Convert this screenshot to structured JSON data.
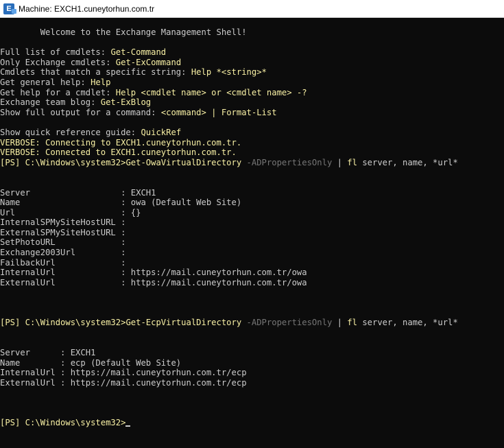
{
  "window": {
    "title": "Machine: EXCH1.cuneytorhun.com.tr"
  },
  "console": {
    "lines": [
      [
        {
          "t": "        Welcome to the Exchange Management Shell!",
          "c": "w"
        }
      ],
      [],
      [
        {
          "t": "Full list of cmdlets: ",
          "c": "w"
        },
        {
          "t": "Get-Command",
          "c": "y"
        }
      ],
      [
        {
          "t": "Only Exchange cmdlets: ",
          "c": "w"
        },
        {
          "t": "Get-ExCommand",
          "c": "y"
        }
      ],
      [
        {
          "t": "Cmdlets that match a specific string: ",
          "c": "w"
        },
        {
          "t": "Help *<string>*",
          "c": "y"
        }
      ],
      [
        {
          "t": "Get general help: ",
          "c": "w"
        },
        {
          "t": "Help",
          "c": "y"
        }
      ],
      [
        {
          "t": "Get help for a cmdlet: ",
          "c": "w"
        },
        {
          "t": "Help <cmdlet name> or <cmdlet name> -?",
          "c": "y"
        }
      ],
      [
        {
          "t": "Exchange team blog: ",
          "c": "w"
        },
        {
          "t": "Get-ExBlog",
          "c": "y"
        }
      ],
      [
        {
          "t": "Show full output for a command: ",
          "c": "w"
        },
        {
          "t": "<command> | Format-List",
          "c": "y"
        }
      ],
      [],
      [
        {
          "t": "Show quick reference guide: ",
          "c": "w"
        },
        {
          "t": "QuickRef",
          "c": "y"
        }
      ],
      [
        {
          "t": "VERBOSE: Connecting to EXCH1.cuneytorhun.com.tr.",
          "c": "y"
        }
      ],
      [
        {
          "t": "VERBOSE: Connected to EXCH1.cuneytorhun.com.tr.",
          "c": "y"
        }
      ],
      [
        {
          "t": "[PS] C:\\Windows\\system32>",
          "c": "y"
        },
        {
          "t": "Get-OwaVirtualDirectory",
          "c": "y"
        },
        {
          "t": " -ADPropertiesOnly",
          "c": "g"
        },
        {
          "t": " | ",
          "c": "w"
        },
        {
          "t": "fl",
          "c": "y"
        },
        {
          "t": " server, name, *url*",
          "c": "w"
        }
      ],
      [],
      [],
      [
        {
          "t": "Server                  : EXCH1",
          "c": "w"
        }
      ],
      [
        {
          "t": "Name                    : owa (Default Web Site)",
          "c": "w"
        }
      ],
      [
        {
          "t": "Url                     : {}",
          "c": "w"
        }
      ],
      [
        {
          "t": "InternalSPMySiteHostURL :",
          "c": "w"
        }
      ],
      [
        {
          "t": "ExternalSPMySiteHostURL :",
          "c": "w"
        }
      ],
      [
        {
          "t": "SetPhotoURL             :",
          "c": "w"
        }
      ],
      [
        {
          "t": "Exchange2003Url         :",
          "c": "w"
        }
      ],
      [
        {
          "t": "FailbackUrl             :",
          "c": "w"
        }
      ],
      [
        {
          "t": "InternalUrl             : https://mail.cuneytorhun.com.tr/owa",
          "c": "w"
        }
      ],
      [
        {
          "t": "ExternalUrl             : https://mail.cuneytorhun.com.tr/owa",
          "c": "w"
        }
      ],
      [],
      [],
      [],
      [
        {
          "t": "[PS] C:\\Windows\\system32>",
          "c": "y"
        },
        {
          "t": "Get-EcpVirtualDirectory",
          "c": "y"
        },
        {
          "t": " -ADPropertiesOnly",
          "c": "g"
        },
        {
          "t": " | ",
          "c": "w"
        },
        {
          "t": "fl",
          "c": "y"
        },
        {
          "t": " server, name, *url*",
          "c": "w"
        }
      ],
      [],
      [],
      [
        {
          "t": "Server      : EXCH1",
          "c": "w"
        }
      ],
      [
        {
          "t": "Name        : ecp (Default Web Site)",
          "c": "w"
        }
      ],
      [
        {
          "t": "InternalUrl : https://mail.cuneytorhun.com.tr/ecp",
          "c": "w"
        }
      ],
      [
        {
          "t": "ExternalUrl : https://mail.cuneytorhun.com.tr/ecp",
          "c": "w"
        }
      ],
      [],
      [],
      [],
      [
        {
          "t": "[PS] C:\\Windows\\system32>",
          "c": "y"
        }
      ]
    ]
  }
}
